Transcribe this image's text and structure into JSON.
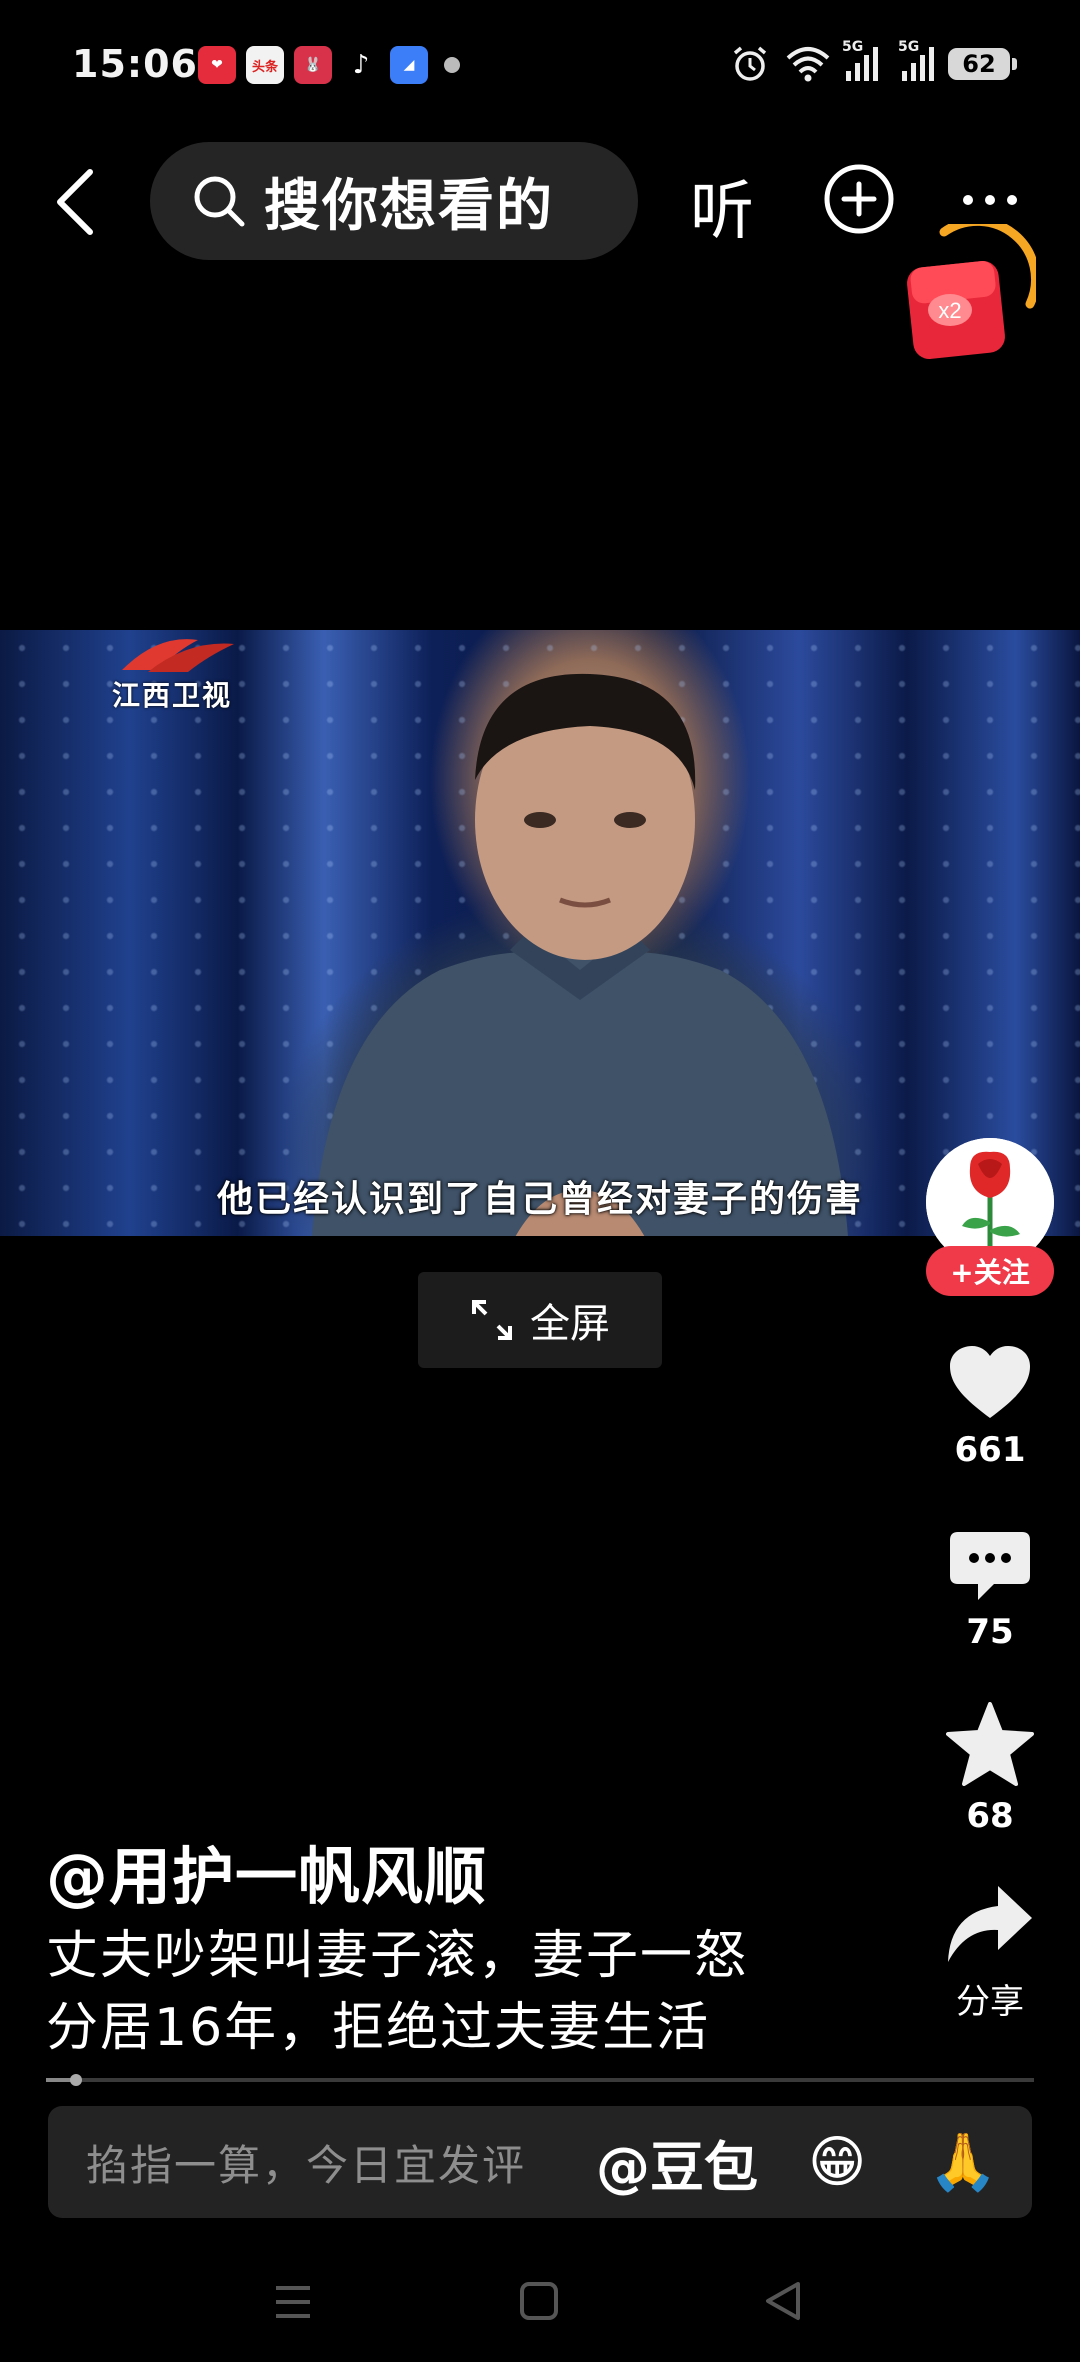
{
  "status_bar": {
    "time": "15:06",
    "notification_icons": [
      "heart-app-icon",
      "toutiao-icon",
      "game-app-icon",
      "tiktok-icon",
      "browser-app-icon"
    ],
    "notif_labels": [
      "❤",
      "头条",
      "🐰",
      "♪",
      "◢"
    ],
    "network": [
      "5G",
      "5G"
    ],
    "battery": "62"
  },
  "top_nav": {
    "search_placeholder": "搜你想看的",
    "listen_label": "听",
    "redpacket_label": "x2"
  },
  "video": {
    "channel_logo": "江西卫视",
    "subtitle": "他已经认识到了自己曾经对妻子的伤害",
    "fullscreen_label": "全屏"
  },
  "right_rail": {
    "follow_label": "+关注",
    "likes": "661",
    "comments": "75",
    "favorites": "68",
    "share_label": "分享"
  },
  "caption": {
    "author": "@用护一帆风顺",
    "line1": "丈夫吵架叫妻子滚，妻子一怒",
    "line2": "分居16年，拒绝过夫妻生活"
  },
  "progress": {
    "fraction": 0.03
  },
  "comment_bar": {
    "placeholder": "掐指一算，今日宜发评",
    "mention": "@豆包",
    "emoji1": "😁",
    "emoji2": "🙏"
  },
  "colors": {
    "accent_red": "#f03a4a",
    "background": "#000000"
  }
}
